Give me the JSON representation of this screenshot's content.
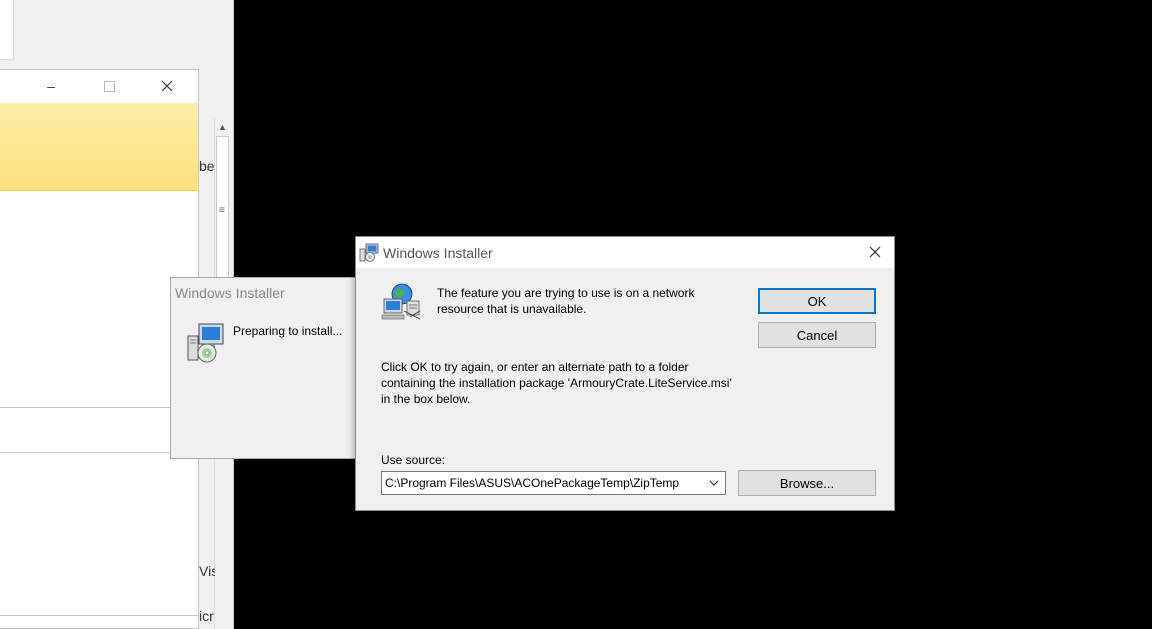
{
  "background_window": {
    "fragments": [
      "be",
      "Vis",
      "icr"
    ]
  },
  "preparing_dialog": {
    "title": "Windows Installer",
    "message": "Preparing to install..."
  },
  "dialog": {
    "title": "Windows Installer",
    "message1": "The feature you are trying to use is on a network resource that is unavailable.",
    "message2": "Click OK to try again, or enter an alternate path to a folder containing the installation package 'ArmouryCrate.LiteService.msi' in the box below.",
    "ok_label": "OK",
    "cancel_label": "Cancel",
    "source_label": "Use source:",
    "source_value": "C:\\Program Files\\ASUS\\ACOnePackageTemp\\ZipTemp",
    "browse_label": "Browse..."
  },
  "icons": {
    "installer": "installer-package-icon",
    "network": "network-computer-icon",
    "close": "close-icon",
    "dropdown": "chevron-down-icon"
  },
  "colors": {
    "accent": "#0078d7",
    "dialog_bg": "#f0f0f0",
    "desktop": "#000000",
    "banner": "#fbe17c"
  }
}
